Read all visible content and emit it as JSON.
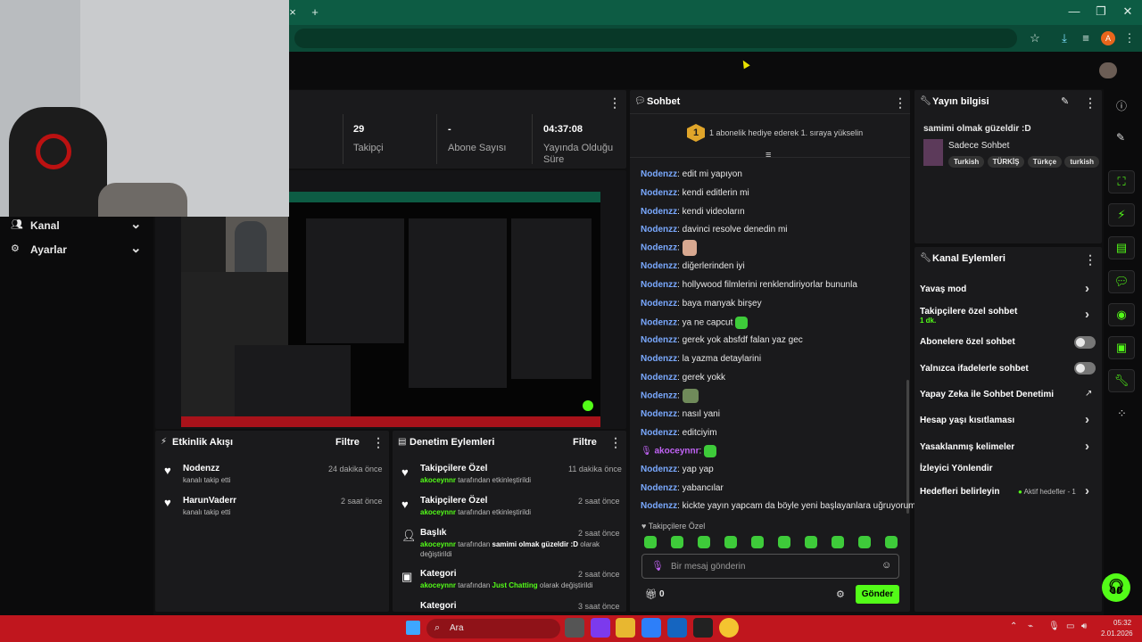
{
  "browser": {
    "tab_plus": "+",
    "tab_close": "×",
    "window_min": "—",
    "window_max": "❐",
    "window_close": "✕",
    "profile_letter": "A"
  },
  "sidebar": {
    "items": [
      {
        "label": "Kanal"
      },
      {
        "label": "Ayarlar"
      }
    ]
  },
  "stats": [
    {
      "value": "29",
      "label": "Takipçi"
    },
    {
      "value": "-",
      "label": "Abone Sayısı"
    },
    {
      "value": "04:37:08",
      "label": "Yayında Olduğu Süre"
    }
  ],
  "activity": {
    "title": "Etkinlik Akışı",
    "filter": "Filtre",
    "items": [
      {
        "user": "Nodenzz",
        "desc": "kanalı takip etti",
        "time": "24 dakika önce"
      },
      {
        "user": "HarunVaderr",
        "desc": "kanalı takip etti",
        "time": "2 saat önce"
      }
    ]
  },
  "moderation": {
    "title": "Denetim Eylemleri",
    "filter": "Filtre",
    "items": [
      {
        "title": "Takipçilere Özel",
        "actor": "akoceynnr",
        "pre": "tarafından etkinleştirildi",
        "post": "",
        "time": "11 dakika önce"
      },
      {
        "title": "Takipçilere Özel",
        "actor": "akoceynnr",
        "pre": "tarafından etkinleştirildi",
        "post": "",
        "time": "2 saat önce"
      },
      {
        "title": "Başlık",
        "actor": "akoceynnr",
        "pre": "tarafından",
        "value": "samimi olmak güzeldir :D",
        "post": "olarak değiştirildi",
        "time": "2 saat önce"
      },
      {
        "title": "Kategori",
        "actor": "akoceynnr",
        "pre": "tarafından",
        "value": "Just Chatting",
        "post": "olarak değiştirildi",
        "time": "2 saat önce"
      },
      {
        "title": "Kategori",
        "actor": "",
        "pre": "",
        "post": "",
        "time": "3 saat önce"
      }
    ]
  },
  "chat": {
    "title": "Sohbet",
    "gift_rank": "1",
    "gift_text": "1 abonelik hediye ederek 1. sıraya yükselin",
    "messages": [
      {
        "user": "Nodenzz",
        "text": "edit mi yapıyon"
      },
      {
        "user": "Nodenzz",
        "text": "kendi editlerin mi"
      },
      {
        "user": "Nodenzz",
        "text": "kendi videoların"
      },
      {
        "user": "Nodenzz",
        "text": "davinci resolve denedin mi"
      },
      {
        "user": "Nodenzz",
        "text": ""
      },
      {
        "user": "Nodenzz",
        "text": "diğerlerinden iyi"
      },
      {
        "user": "Nodenzz",
        "text": "hollywood filmlerini renklendiriyorlar bununla"
      },
      {
        "user": "Nodenzz",
        "text": "baya manyak birşey"
      },
      {
        "user": "Nodenzz",
        "text": "ya ne capcut"
      },
      {
        "user": "Nodenzz",
        "text": "gerek yok absfdf falan yaz gec"
      },
      {
        "user": "Nodenzz",
        "text": "la yazma detaylarini"
      },
      {
        "user": "Nodenzz",
        "text": "gerek yokk"
      },
      {
        "user": "Nodenzz",
        "text": ""
      },
      {
        "user": "Nodenzz",
        "text": "nasıl yani"
      },
      {
        "user": "Nodenzz",
        "text": "editciyim"
      },
      {
        "user": "akoceynnr",
        "text": ""
      },
      {
        "user": "Nodenzz",
        "text": "yap yap"
      },
      {
        "user": "Nodenzz",
        "text": "yabancılar"
      },
      {
        "user": "Nodenzz",
        "text": "kickte yayın yapcam da böyle yeni başlayanlara uğruyorum"
      }
    ],
    "mode_label": "Takipçilere Özel",
    "input_placeholder": "Bir mesaj gönderin",
    "points": "0",
    "send_label": "Gönder"
  },
  "stream_info": {
    "title": "Yayın bilgisi",
    "stream_title": "samimi olmak güzeldir :D",
    "category": "Sadece Sohbet",
    "tags": [
      "Turkish",
      "TÜRKİŞ",
      "Türkçe",
      "turkish"
    ]
  },
  "channel_actions": {
    "title": "Kanal Eylemleri",
    "items": [
      {
        "label": "Yavaş mod",
        "sub": "",
        "control": "chevron"
      },
      {
        "label": "Takipçilere özel sohbet",
        "sub": "1 dk.",
        "control": "chevron"
      },
      {
        "label": "Abonelere özel sohbet",
        "sub": "",
        "control": "toggle"
      },
      {
        "label": "Yalnızca ifadelerle sohbet",
        "sub": "",
        "control": "toggle"
      },
      {
        "label": "Yapay Zeka ile Sohbet Denetimi",
        "sub": "",
        "control": "external"
      },
      {
        "label": "Hesap yaşı kısıtlaması",
        "sub": "",
        "control": "chevron"
      },
      {
        "label": "Yasaklanmış kelimeler",
        "sub": "",
        "control": "chevron"
      },
      {
        "label": "İzleyici Yönlendir",
        "sub": "",
        "control": "none"
      },
      {
        "label": "Hedefleri belirleyin",
        "sub": "",
        "control": "goal"
      }
    ],
    "goal_status": "Aktif hedefler - 1"
  },
  "taskbar": {
    "search": "Ara",
    "time": "05:32",
    "date": "2.01.2026"
  },
  "colors": {
    "accent": "#53fc18",
    "username": "#7aa9ff",
    "chrome": "#0d5c44",
    "taskbar": "#c0161e"
  }
}
